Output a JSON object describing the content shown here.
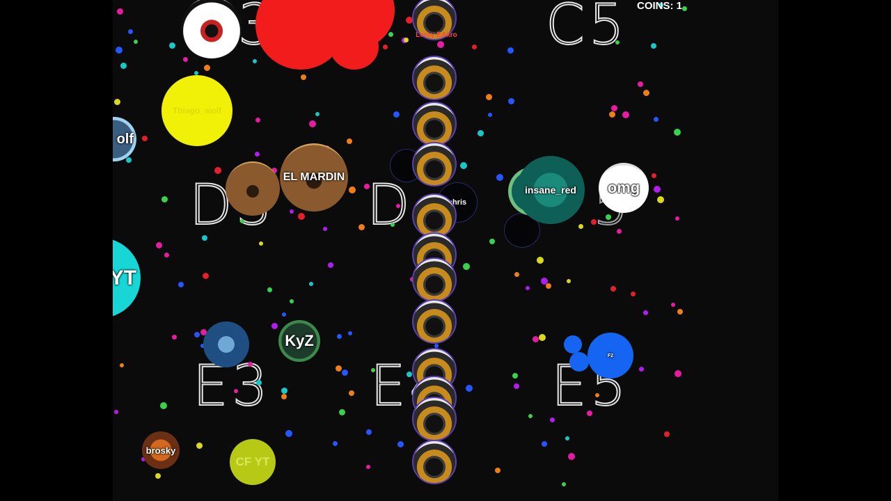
{
  "hud": {
    "coins_label": "COINS: 1"
  },
  "sectors": [
    "C5",
    "D3",
    "D",
    "E3",
    "E4",
    "E5",
    "5",
    "3"
  ],
  "players": {
    "top_snake": "Leroy EAkro",
    "el_mardin": "EL MARDIN",
    "chris": "chris",
    "insane_red": "insane_red",
    "omg": "omg",
    "kyz": "KyZ",
    "wolf_partial": "olf",
    "yt_partial": "YT",
    "yellow_faded": "Thiago_wolf",
    "brosky": "brosky",
    "cf_yt": "CF YT",
    "blue_small": "F2"
  },
  "colors": {
    "background": "#0b0b0c",
    "red_cell": "#f21c1c",
    "yellow_cell": "#f1f107",
    "cyan_cell": "#19d6d6",
    "blue_cell": "#1565f2",
    "lime_cell": "#b7c914"
  }
}
